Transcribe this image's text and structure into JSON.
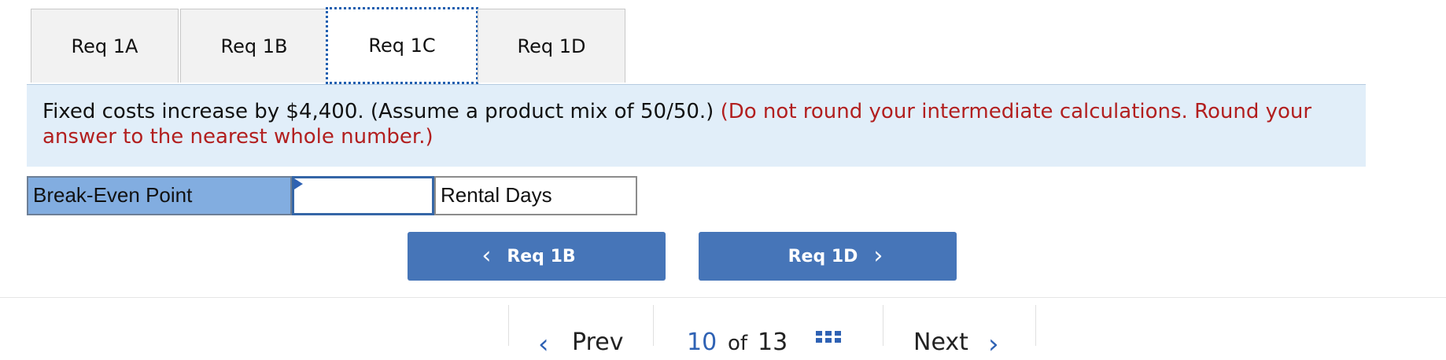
{
  "tabs": [
    {
      "label": "Req 1A",
      "active": false
    },
    {
      "label": "Req 1B",
      "active": false
    },
    {
      "label": "Req 1C",
      "active": true
    },
    {
      "label": "Req 1D",
      "active": false
    }
  ],
  "instructions": {
    "main": "Fixed costs increase by $4,400. (Assume a product mix of 50/50.)",
    "note": "(Do not round your intermediate calculations. Round your answer to the nearest whole number.)"
  },
  "break_even": {
    "label": "Break-Even Point",
    "value": "",
    "unit": "Rental Days"
  },
  "nav": {
    "prev_label": "Req 1B",
    "next_label": "Req 1D",
    "prev_chevron": "‹",
    "next_chevron": "›"
  },
  "pager": {
    "prev_label": "Prev",
    "current": "10",
    "of_label": "of",
    "total": "13",
    "next_label": "Next"
  },
  "icons": {
    "prev_chevron": "chevron-left-icon",
    "next_chevron": "chevron-right-icon",
    "grid": "grid-icon"
  },
  "colors": {
    "tab_bg": "#f2f2f2",
    "panel_bg": "#e1eef9",
    "note_red": "#b21f1f",
    "label_bg": "#82ade0",
    "button_blue": "#4675b8",
    "accent_blue": "#2f62b4"
  }
}
